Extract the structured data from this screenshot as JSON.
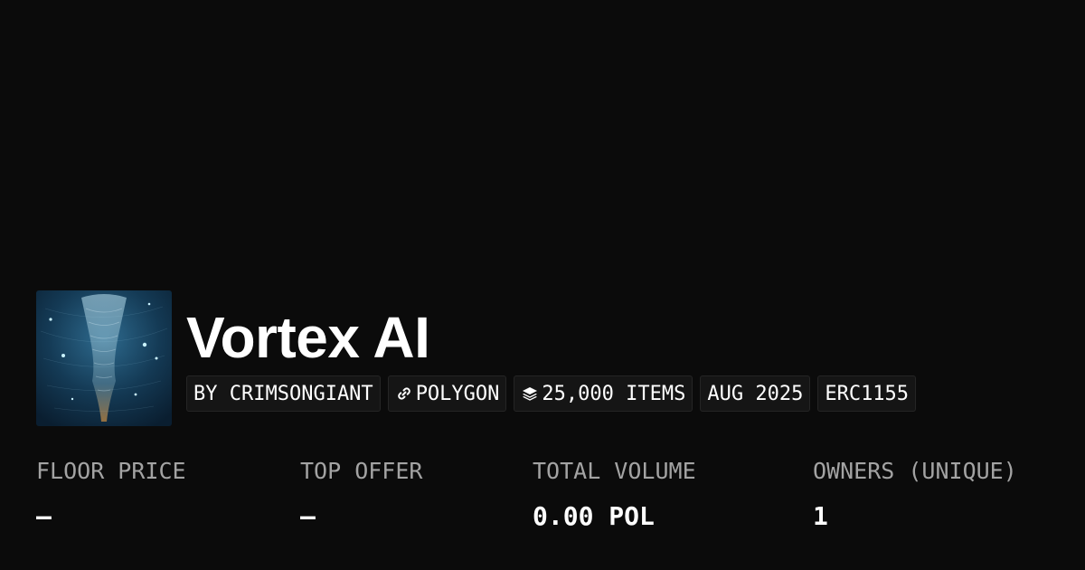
{
  "collection": {
    "title": "Vortex AI",
    "thumbnail_icon": "vortex-artwork-image"
  },
  "badges": {
    "creator": "BY CRIMSONGIANT",
    "chain": "POLYGON",
    "chain_icon": "link-icon",
    "items": "25,000 ITEMS",
    "items_icon": "layers-icon",
    "date": "AUG 2025",
    "standard": "ERC1155"
  },
  "stats": {
    "floor_price": {
      "label": "FLOOR PRICE",
      "value": "–"
    },
    "top_offer": {
      "label": "TOP OFFER",
      "value": "–"
    },
    "total_volume": {
      "label": "TOTAL VOLUME",
      "value": "0.00 POL"
    },
    "owners": {
      "label": "OWNERS (UNIQUE)",
      "value": "1"
    }
  },
  "colors": {
    "background": "#0b0b0b",
    "badge_background": "#151515",
    "label_gray": "#a3a3a3",
    "text": "#ffffff"
  }
}
